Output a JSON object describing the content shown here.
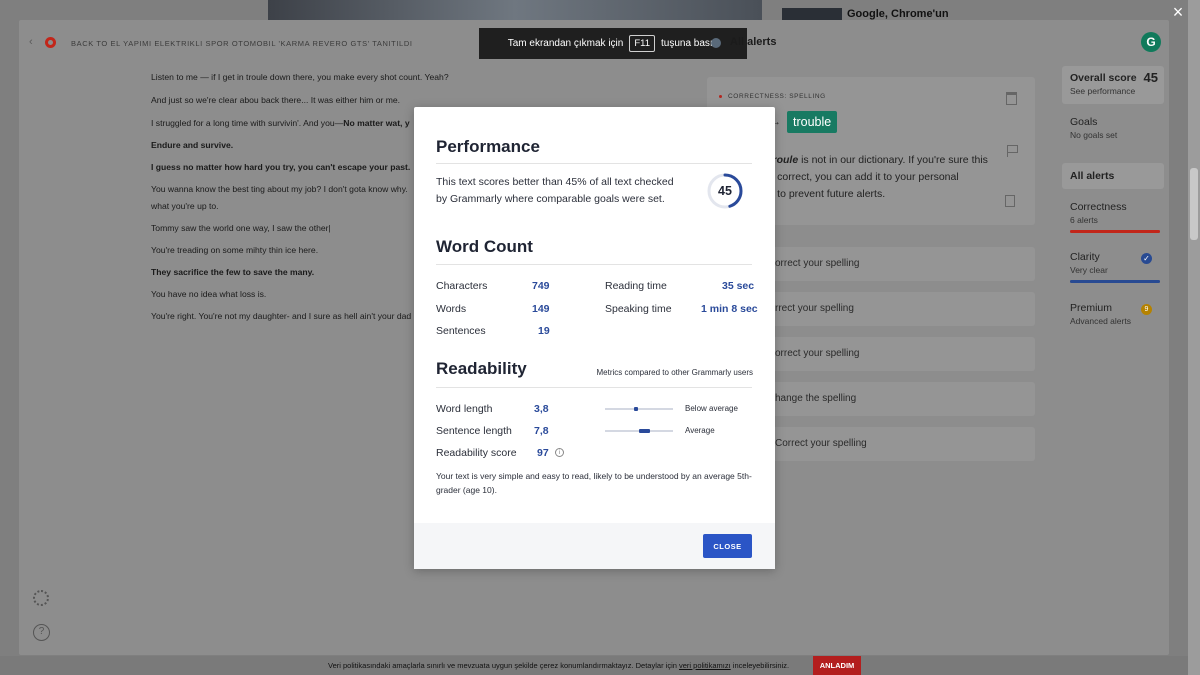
{
  "background": {
    "headline": "Google, Chrome'un",
    "cookie_text_1": "Veri politikasındaki amaçlarla sınırlı ve mevzuata uygun şekilde çerez konumlandırmaktayız. Detaylar için",
    "cookie_link": "veri politikamızı",
    "cookie_text_2": "inceleyebilirsiniz.",
    "cookie_button": "ANLADIM",
    "close_glyph": "×"
  },
  "editor": {
    "back_label": "BACK TO EL YAPIMI ELEKTRIKLI SPOR OTOMOBIL 'KARMA REVERO GTS' TANITILDI",
    "fullscreen_before": "Tam ekrandan çıkmak için",
    "fullscreen_key": "F11",
    "fullscreen_after": "tuşuna basın",
    "alerts_heading": "All alerts",
    "avatar_letter": "G",
    "lines": [
      {
        "text": "Listen to me — if I get in troule down there, you make every shot count. Yeah?",
        "bold": false
      },
      {
        "text": "And just so we're clear abou back there... It was either him or me.",
        "bold": false
      },
      {
        "text": "I struggled for a long time with survivin'. And you—",
        "bold_tail": "No matter wat, y",
        "bold": false
      },
      {
        "text": "Endure and survive.",
        "bold": true
      },
      {
        "text": "I guess no matter how hard you try, you can't escape your past.",
        "bold": true
      },
      {
        "text": "You wanna know the best ting about my job? I don't gota know why.",
        "bold": false
      },
      {
        "text": "what you're up to.",
        "bold": false
      },
      {
        "text": "Tommy saw the world one way, I saw the other|",
        "bold": false
      },
      {
        "text": "You're treading on some mihty thin ice here.",
        "bold": false
      },
      {
        "text": "They sacrifice the few to save the many.",
        "bold": true
      },
      {
        "text": "You have no idea what loss is.",
        "bold": false
      },
      {
        "text": "You're right. You're not my daughter- and I sure as hell ain't your dad",
        "bold": false
      }
    ]
  },
  "alert_card": {
    "category": "CORRECTNESS: SPELLING",
    "arrow": "→",
    "suggestion": "trouble",
    "desc_word": "troule",
    "desc_rest": "is not in our dictionary. If you're sure this is correct, you can add it to your personal dictionary to prevent future alerts.",
    "desc_visible_1": "is not in our dictionary. If you're sure this",
    "desc_visible_2": "s correct, you can add it to your personal",
    "desc_visible_3": "y to prevent future alerts."
  },
  "alert_rows": [
    "orrect your spelling",
    "rrect your spelling",
    "orrect your spelling",
    "hange the spelling",
    "Correct your spelling"
  ],
  "sidebar": {
    "overall_label": "Overall score",
    "overall_sub": "See performance",
    "overall_score": "45",
    "goals_label": "Goals",
    "goals_sub": "No goals set",
    "all_alerts": "All alerts",
    "correctness": "Correctness",
    "correctness_sub": "6 alerts",
    "clarity": "Clarity",
    "clarity_sub": "Very clear",
    "premium": "Premium",
    "premium_sub": "Advanced alerts",
    "premium_count": "9",
    "colors": {
      "correctness": "#c2261a",
      "clarity": "#284a92"
    }
  },
  "modal": {
    "title_performance": "Performance",
    "perf_text_1": "This text scores better than 45% of all text checked",
    "perf_text_2": "by Grammarly where comparable goals were set.",
    "score": "45",
    "score_fraction": 0.45,
    "title_wordcount": "Word Count",
    "characters_label": "Characters",
    "characters": "749",
    "words_label": "Words",
    "words": "149",
    "sentences_label": "Sentences",
    "sentences": "19",
    "reading_label": "Reading time",
    "reading": "35 sec",
    "speaking_label": "Speaking time",
    "speaking": "1 min 8 sec",
    "title_readability": "Readability",
    "metrics_note": "Metrics compared to other Grammarly users",
    "word_length_label": "Word length",
    "word_length": "3,8",
    "word_length_level": "Below average",
    "word_length_pos": 0.45,
    "sentence_length_label": "Sentence length",
    "sentence_length": "7,8",
    "sentence_length_level": "Average",
    "sentence_length_pos": 0.58,
    "readability_label": "Readability score",
    "readability": "97",
    "info_glyph": "i",
    "note_1": "Your text is very simple and easy to read, likely to be understood by an average 5th-",
    "note_2": "grader (age 10).",
    "close": "CLOSE",
    "accent": "#2a4a9a"
  }
}
